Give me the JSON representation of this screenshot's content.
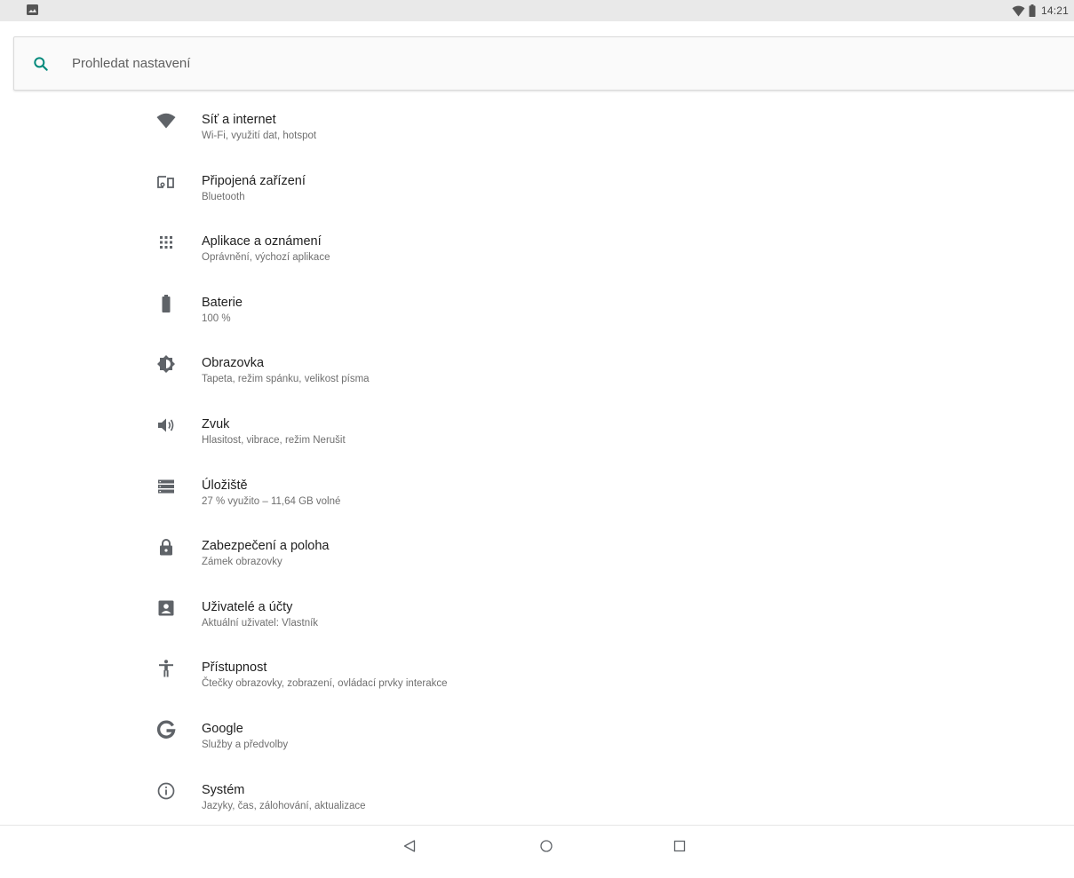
{
  "status_bar": {
    "time": "14:21",
    "left_icon": "image-notification-icon",
    "right_icons": [
      "wifi-icon",
      "battery-icon"
    ]
  },
  "search": {
    "placeholder": "Prohledat nastavení"
  },
  "settings": [
    {
      "icon": "wifi-icon",
      "title": "Síť a internet",
      "subtitle": "Wi-Fi, využití dat, hotspot"
    },
    {
      "icon": "devices-icon",
      "title": "Připojená zařízení",
      "subtitle": "Bluetooth"
    },
    {
      "icon": "apps-grid-icon",
      "title": "Aplikace a oznámení",
      "subtitle": "Oprávnění, výchozí aplikace"
    },
    {
      "icon": "battery-icon",
      "title": "Baterie",
      "subtitle": "100 %"
    },
    {
      "icon": "brightness-icon",
      "title": "Obrazovka",
      "subtitle": "Tapeta, režim spánku, velikost písma"
    },
    {
      "icon": "volume-icon",
      "title": "Zvuk",
      "subtitle": "Hlasitost, vibrace, režim Nerušit"
    },
    {
      "icon": "storage-icon",
      "title": "Úložiště",
      "subtitle": "27 % využito – 11,64 GB volné"
    },
    {
      "icon": "lock-icon",
      "title": "Zabezpečení a poloha",
      "subtitle": "Zámek obrazovky"
    },
    {
      "icon": "account-icon",
      "title": "Uživatelé a účty",
      "subtitle": "Aktuální uživatel: Vlastník"
    },
    {
      "icon": "accessibility-icon",
      "title": "Přístupnost",
      "subtitle": "Čtečky obrazovky, zobrazení, ovládací prvky interakce"
    },
    {
      "icon": "google-icon",
      "title": "Google",
      "subtitle": "Služby a předvolby"
    },
    {
      "icon": "info-icon",
      "title": "Systém",
      "subtitle": "Jazyky, čas, zálohování, aktualizace"
    }
  ],
  "nav_bar": {
    "buttons": [
      "back-icon",
      "home-icon",
      "recents-icon"
    ]
  },
  "colors": {
    "accent": "#00897b",
    "icon": "#5f6368",
    "title": "#212121",
    "subtitle": "#6f6f6f",
    "status_bar": "#e9e9e9"
  }
}
